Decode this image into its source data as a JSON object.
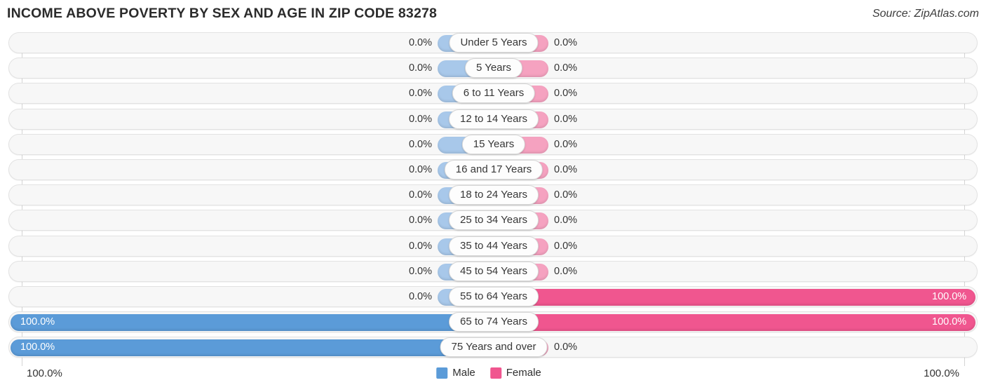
{
  "header": {
    "title": "INCOME ABOVE POVERTY BY SEX AND AGE IN ZIP CODE 83278",
    "source": "Source: ZipAtlas.com"
  },
  "legend": {
    "male_label": "Male",
    "female_label": "Female",
    "male_color": "#5b9bd8",
    "female_color": "#f0568f"
  },
  "axis": {
    "left_label": "100.0%",
    "right_label": "100.0%"
  },
  "colors": {
    "male_bar": "#5b9bd8",
    "female_bar": "#f0568f",
    "male_stub": "#a8c8ea",
    "female_stub": "#f5a2c0",
    "track_bg": "#f7f7f7",
    "track_border": "#e2e2e2"
  },
  "chart_data": {
    "type": "bar",
    "title": "INCOME ABOVE POVERTY BY SEX AND AGE IN ZIP CODE 83278",
    "xlabel": "",
    "ylabel": "",
    "xlim": [
      0,
      100
    ],
    "grid": false,
    "legend_position": "bottom-center",
    "orientation": "horizontal-diverging",
    "categories": [
      "Under 5 Years",
      "5 Years",
      "6 to 11 Years",
      "12 to 14 Years",
      "15 Years",
      "16 and 17 Years",
      "18 to 24 Years",
      "25 to 34 Years",
      "35 to 44 Years",
      "45 to 54 Years",
      "55 to 64 Years",
      "65 to 74 Years",
      "75 Years and over"
    ],
    "series": [
      {
        "name": "Male",
        "values": [
          0.0,
          0.0,
          0.0,
          0.0,
          0.0,
          0.0,
          0.0,
          0.0,
          0.0,
          0.0,
          0.0,
          100.0,
          100.0
        ]
      },
      {
        "name": "Female",
        "values": [
          0.0,
          0.0,
          0.0,
          0.0,
          0.0,
          0.0,
          0.0,
          0.0,
          0.0,
          0.0,
          100.0,
          100.0,
          0.0
        ]
      }
    ]
  },
  "rows": [
    {
      "label": "Under 5 Years",
      "male": 0.0,
      "female": 0.0,
      "male_text": "0.0%",
      "female_text": "0.0%"
    },
    {
      "label": "5 Years",
      "male": 0.0,
      "female": 0.0,
      "male_text": "0.0%",
      "female_text": "0.0%"
    },
    {
      "label": "6 to 11 Years",
      "male": 0.0,
      "female": 0.0,
      "male_text": "0.0%",
      "female_text": "0.0%"
    },
    {
      "label": "12 to 14 Years",
      "male": 0.0,
      "female": 0.0,
      "male_text": "0.0%",
      "female_text": "0.0%"
    },
    {
      "label": "15 Years",
      "male": 0.0,
      "female": 0.0,
      "male_text": "0.0%",
      "female_text": "0.0%"
    },
    {
      "label": "16 and 17 Years",
      "male": 0.0,
      "female": 0.0,
      "male_text": "0.0%",
      "female_text": "0.0%"
    },
    {
      "label": "18 to 24 Years",
      "male": 0.0,
      "female": 0.0,
      "male_text": "0.0%",
      "female_text": "0.0%"
    },
    {
      "label": "25 to 34 Years",
      "male": 0.0,
      "female": 0.0,
      "male_text": "0.0%",
      "female_text": "0.0%"
    },
    {
      "label": "35 to 44 Years",
      "male": 0.0,
      "female": 0.0,
      "male_text": "0.0%",
      "female_text": "0.0%"
    },
    {
      "label": "45 to 54 Years",
      "male": 0.0,
      "female": 0.0,
      "male_text": "0.0%",
      "female_text": "0.0%"
    },
    {
      "label": "55 to 64 Years",
      "male": 0.0,
      "female": 100.0,
      "male_text": "0.0%",
      "female_text": "100.0%"
    },
    {
      "label": "65 to 74 Years",
      "male": 100.0,
      "female": 100.0,
      "male_text": "100.0%",
      "female_text": "100.0%"
    },
    {
      "label": "75 Years and over",
      "male": 100.0,
      "female": 0.0,
      "male_text": "100.0%",
      "female_text": "0.0%"
    }
  ]
}
